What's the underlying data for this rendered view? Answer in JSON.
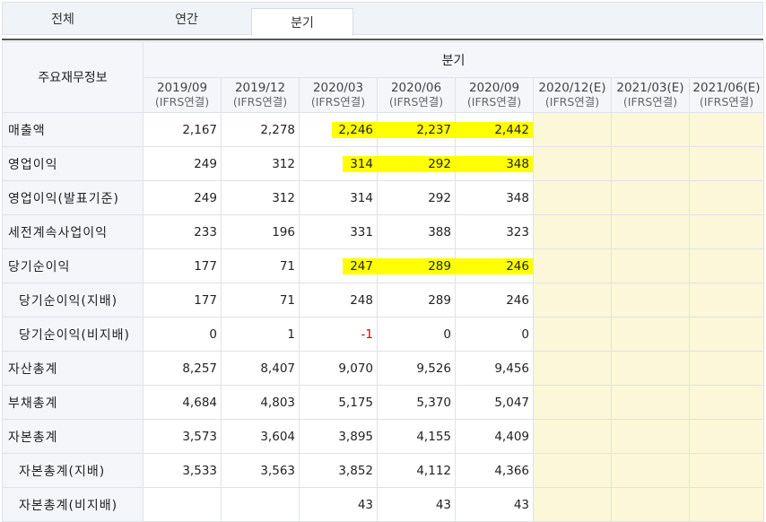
{
  "tabs": [
    {
      "label": "전체"
    },
    {
      "label": "연간"
    },
    {
      "label": "분기"
    }
  ],
  "table": {
    "corner_label": "주요재무정보",
    "group_label": "분기",
    "periods": [
      {
        "date": "2019/09",
        "sub": "(IFRS연결)"
      },
      {
        "date": "2019/12",
        "sub": "(IFRS연결)"
      },
      {
        "date": "2020/03",
        "sub": "(IFRS연결)"
      },
      {
        "date": "2020/06",
        "sub": "(IFRS연결)"
      },
      {
        "date": "2020/09",
        "sub": "(IFRS연결)"
      },
      {
        "date": "2020/12(E)",
        "sub": "(IFRS연결)"
      },
      {
        "date": "2021/03(E)",
        "sub": "(IFRS연결)"
      },
      {
        "date": "2021/06(E)",
        "sub": "(IFRS연결)"
      }
    ],
    "rows": [
      {
        "label": "매출액",
        "values": [
          "2,167",
          "2,278",
          "2,246",
          "2,237",
          "2,442",
          "",
          "",
          ""
        ]
      },
      {
        "label": "영업이익",
        "values": [
          "249",
          "312",
          "314",
          "292",
          "348",
          "",
          "",
          ""
        ]
      },
      {
        "label": "영업이익(발표기준)",
        "values": [
          "249",
          "312",
          "314",
          "292",
          "348",
          "",
          "",
          ""
        ]
      },
      {
        "label": "세전계속사업이익",
        "values": [
          "233",
          "196",
          "331",
          "388",
          "323",
          "",
          "",
          ""
        ]
      },
      {
        "label": "당기순이익",
        "values": [
          "177",
          "71",
          "247",
          "289",
          "246",
          "",
          "",
          ""
        ]
      },
      {
        "label": "당기순이익(지배)",
        "values": [
          "177",
          "71",
          "248",
          "289",
          "246",
          "",
          "",
          ""
        ]
      },
      {
        "label": "당기순이익(비지배)",
        "values": [
          "0",
          "1",
          "-1",
          "0",
          "0",
          "",
          "",
          ""
        ]
      },
      {
        "label": "자산총계",
        "values": [
          "8,257",
          "8,407",
          "9,070",
          "9,526",
          "9,456",
          "",
          "",
          ""
        ]
      },
      {
        "label": "부채총계",
        "values": [
          "4,684",
          "4,803",
          "5,175",
          "5,370",
          "5,047",
          "",
          "",
          ""
        ]
      },
      {
        "label": "자본총계",
        "values": [
          "3,573",
          "3,604",
          "3,895",
          "4,155",
          "4,409",
          "",
          "",
          ""
        ]
      },
      {
        "label": "자본총계(지배)",
        "values": [
          "3,533",
          "3,563",
          "3,852",
          "4,112",
          "4,366",
          "",
          "",
          ""
        ]
      },
      {
        "label": "자본총계(비지배)",
        "values": [
          "",
          "",
          "43",
          "43",
          "43",
          "",
          "",
          ""
        ]
      }
    ]
  },
  "colors": {
    "highlight": "#ffff00",
    "estimate_bg": "#fbf7d8",
    "header_bg": "#f4f6f9",
    "negative": "#dd0000"
  }
}
